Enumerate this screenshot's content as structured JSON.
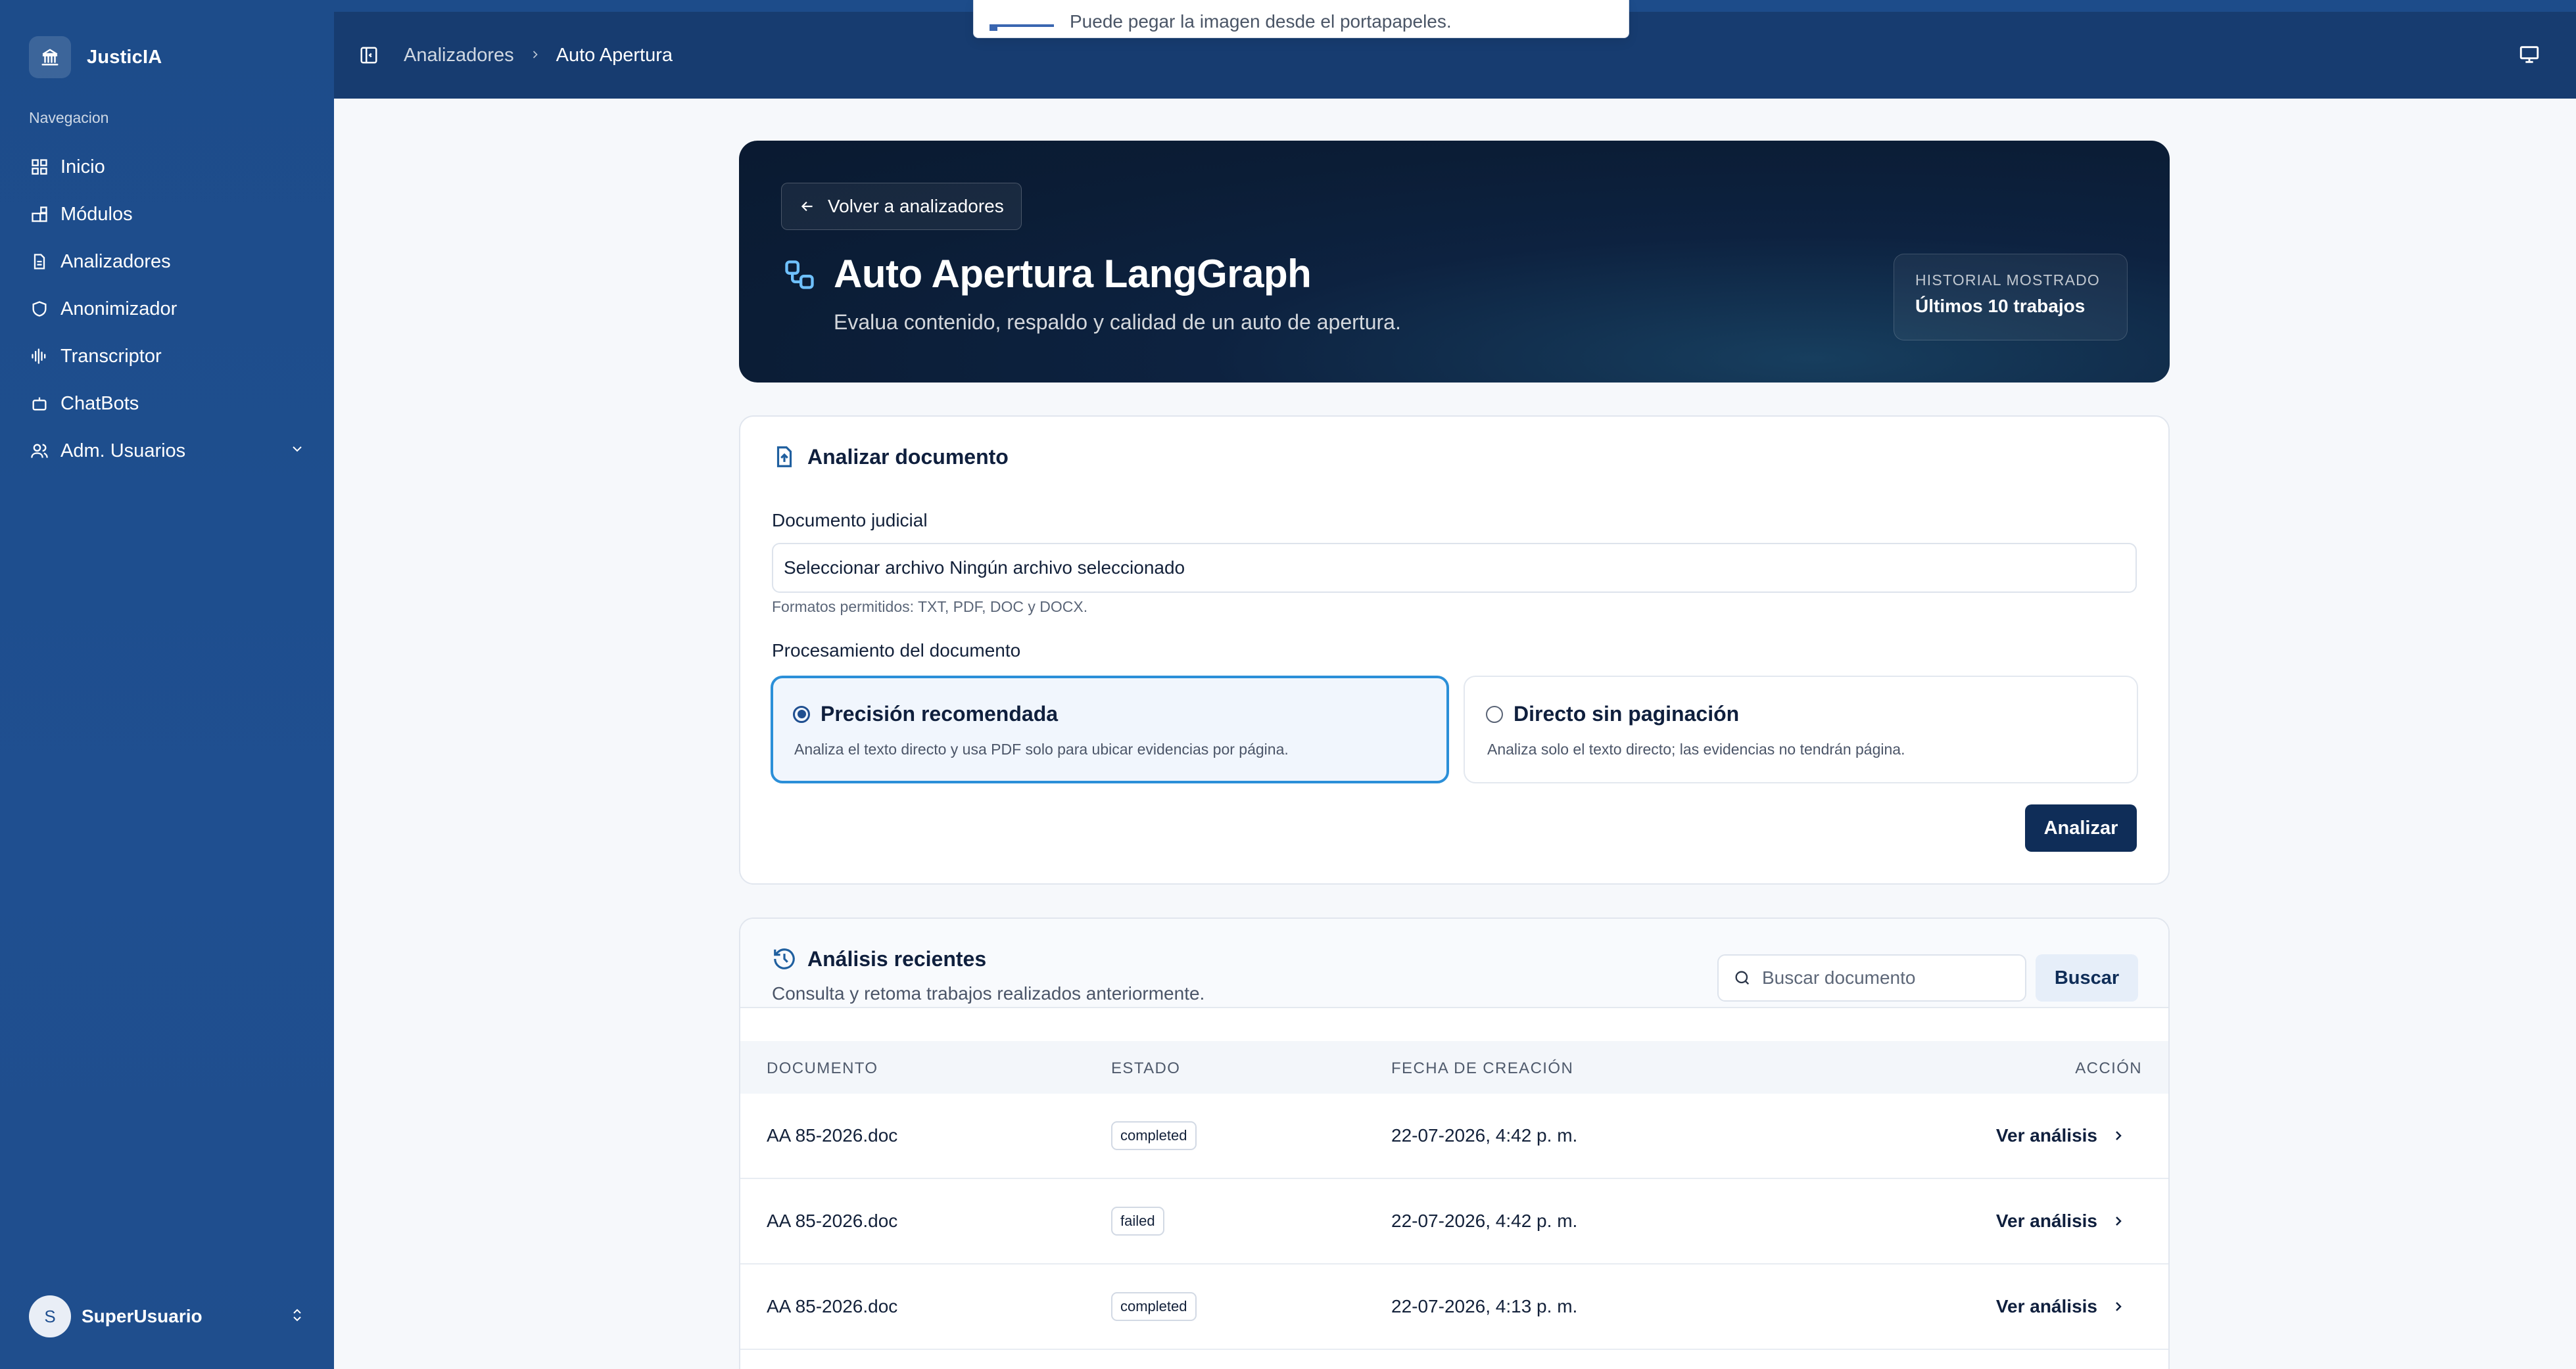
{
  "colors": {
    "sidebar": "#1d4c8a",
    "topbar": "#173c70",
    "hero": "#0b1d36",
    "primary_button": "#0f2d58",
    "selected_option_border": "#2b8fd8"
  },
  "toast": {
    "text": "Puede pegar la imagen desde el portapapeles."
  },
  "sidebar": {
    "brand": "JusticIA",
    "brand_icon": "bank-icon",
    "nav_title": "Navegacion",
    "items": [
      {
        "label": "Inicio",
        "icon": "grid-icon"
      },
      {
        "label": "Módulos",
        "icon": "blocks-icon"
      },
      {
        "label": "Analizadores",
        "icon": "document-icon"
      },
      {
        "label": "Anonimizador",
        "icon": "shield-icon"
      },
      {
        "label": "Transcriptor",
        "icon": "audio-wave-icon"
      },
      {
        "label": "ChatBots",
        "icon": "bot-icon"
      },
      {
        "label": "Adm. Usuarios",
        "icon": "users-icon"
      }
    ],
    "user": {
      "initial": "S",
      "name": "SuperUsuario"
    }
  },
  "topbar": {
    "breadcrumb": [
      "Analizadores",
      "Auto Apertura"
    ]
  },
  "hero": {
    "back_label": "Volver a analizadores",
    "title": "Auto Apertura LangGraph",
    "subtitle": "Evalua contenido, respaldo y calidad de un auto de apertura.",
    "history_key": "HISTORIAL MOSTRADO",
    "history_value": "Últimos 10 trabajos"
  },
  "analyze": {
    "title": "Analizar documento",
    "doc_label": "Documento judicial",
    "file_value": "Seleccionar archivo Ningún archivo seleccionado",
    "hint": "Formatos permitidos: TXT, PDF, DOC y DOCX.",
    "processing_label": "Procesamiento del documento",
    "options": [
      {
        "title": "Precisión recomendada",
        "desc": "Analiza el texto directo y usa PDF solo para ubicar evidencias por página.",
        "selected": true
      },
      {
        "title": "Directo sin paginación",
        "desc": "Analiza solo el texto directo; las evidencias no tendrán página.",
        "selected": false
      }
    ],
    "submit": "Analizar"
  },
  "recent": {
    "title": "Análisis recientes",
    "subtitle": "Consulta y retoma trabajos realizados anteriormente.",
    "search_placeholder": "Buscar documento",
    "search_button": "Buscar",
    "columns": [
      "DOCUMENTO",
      "ESTADO",
      "FECHA DE CREACIÓN",
      "ACCIÓN"
    ],
    "rows": [
      {
        "document": "AA 85-2026.doc",
        "status": "completed",
        "date": "22-07-2026, 4:42 p. m.",
        "action": "Ver análisis"
      },
      {
        "document": "AA 85-2026.doc",
        "status": "failed",
        "date": "22-07-2026, 4:42 p. m.",
        "action": "Ver análisis"
      },
      {
        "document": "AA 85-2026.doc",
        "status": "completed",
        "date": "22-07-2026, 4:13 p. m.",
        "action": "Ver análisis"
      }
    ]
  }
}
